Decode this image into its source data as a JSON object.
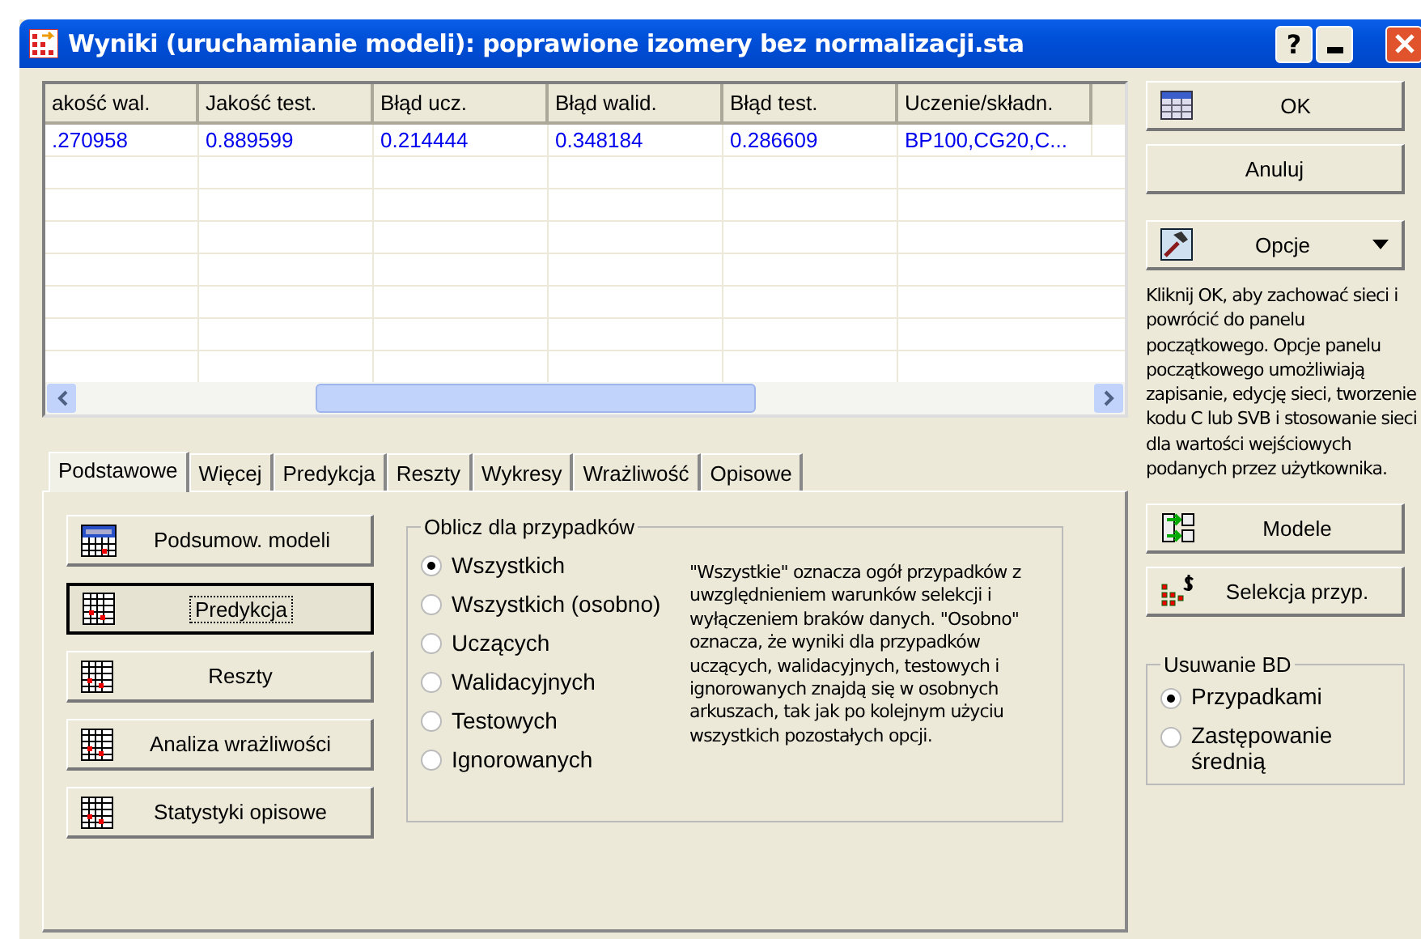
{
  "window": {
    "title": "Wyniki (uruchamianie modeli): poprawione izomery bez normalizacji.sta",
    "help_button": "?"
  },
  "table": {
    "columns": [
      "akość wal.",
      "Jakość test.",
      "Błąd ucz.",
      "Błąd walid.",
      "Błąd test.",
      "Uczenie/składn."
    ],
    "rows": [
      [
        ".270958",
        "0.889599",
        "0.214444",
        "0.348184",
        "0.286609",
        "BP100,CG20,C..."
      ]
    ]
  },
  "tabs": [
    {
      "label": "Podstawowe",
      "selected": true
    },
    {
      "label": "Więcej",
      "selected": false
    },
    {
      "label": "Predykcja",
      "selected": false
    },
    {
      "label": "Reszty",
      "selected": false
    },
    {
      "label": "Wykresy",
      "selected": false
    },
    {
      "label": "Wrażliwość",
      "selected": false
    },
    {
      "label": "Opisowe",
      "selected": false
    }
  ],
  "actions": [
    {
      "label": "Podsumow. modeli",
      "kind": "summary",
      "focused": false
    },
    {
      "label": "Predykcja",
      "kind": "grid",
      "focused": true
    },
    {
      "label": "Reszty",
      "kind": "grid",
      "focused": false
    },
    {
      "label": "Analiza wrażliwości",
      "kind": "grid",
      "focused": false
    },
    {
      "label": "Statystyki opisowe",
      "kind": "grid",
      "focused": false
    }
  ],
  "cases_group": {
    "title": "Oblicz dla przypadków",
    "options": [
      {
        "label": "Wszystkich",
        "selected": true
      },
      {
        "label": "Wszystkich (osobno)",
        "selected": false
      },
      {
        "label": "Uczących",
        "selected": false
      },
      {
        "label": "Walidacyjnych",
        "selected": false
      },
      {
        "label": "Testowych",
        "selected": false
      },
      {
        "label": "Ignorowanych",
        "selected": false
      }
    ],
    "description": "\"Wszystkie\" oznacza ogół przypadków z uwzględnieniem warunków selekcji i wyłączeniem braków danych. \"Osobno\" oznacza, że wyniki dla przypadków uczących, walidacyjnych, testowych i ignorowanych znajdą się w osobnych arkuszach, tak jak po kolejnym użyciu wszystkich pozostałych opcji."
  },
  "side": {
    "ok": "OK",
    "cancel": "Anuluj",
    "options": "Opcje",
    "help": "Kliknij OK, aby zachować sieci i powrócić do panelu początkowego. Opcje panelu początkowego umożliwiają zapisanie, edycję sieci, tworzenie kodu C lub SVB i stosowanie sieci dla wartości wejściowych podanych przez użytkownika.",
    "models": "Modele",
    "selection": "Selekcja przyp."
  },
  "missing_group": {
    "title": "Usuwanie BD",
    "options": [
      {
        "label": "Przypadkami",
        "selected": true
      },
      {
        "label": "Zastępowanie średnią",
        "selected": false
      }
    ]
  }
}
